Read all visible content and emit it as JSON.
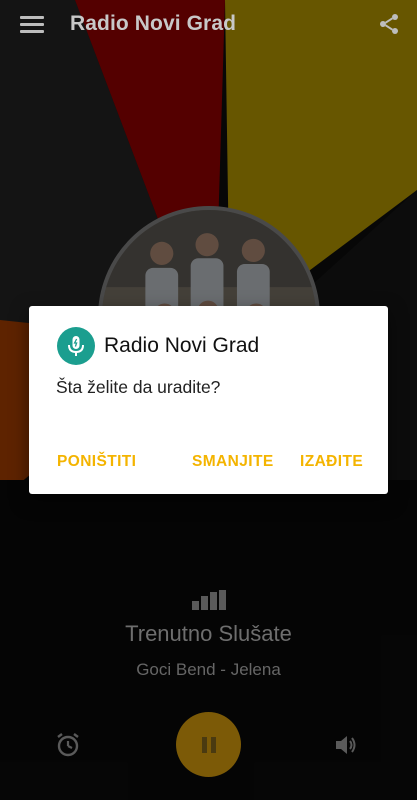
{
  "app_bar": {
    "title": "Radio Novi Grad",
    "menu_icon": "hamburger-menu-icon",
    "share_icon": "share-icon"
  },
  "player": {
    "now_playing_label": "Trenutno Slušate",
    "track": "Goci Bend - Jelena",
    "signal_icon": "signal-bars-icon",
    "alarm_icon": "alarm-clock-icon",
    "play_pause_icon": "pause-icon",
    "volume_icon": "volume-icon",
    "accent_color": "#f4b400"
  },
  "dialog": {
    "title": "Radio Novi Grad",
    "message": "Šta želite da uradite?",
    "icon": "radio-microphone-icon",
    "icon_color": "#1b9e8f",
    "buttons": {
      "cancel": "PONIŠTITI",
      "minimize": "SMANJITE",
      "exit": "IZAĐITE"
    },
    "button_color": "#f4b400"
  }
}
